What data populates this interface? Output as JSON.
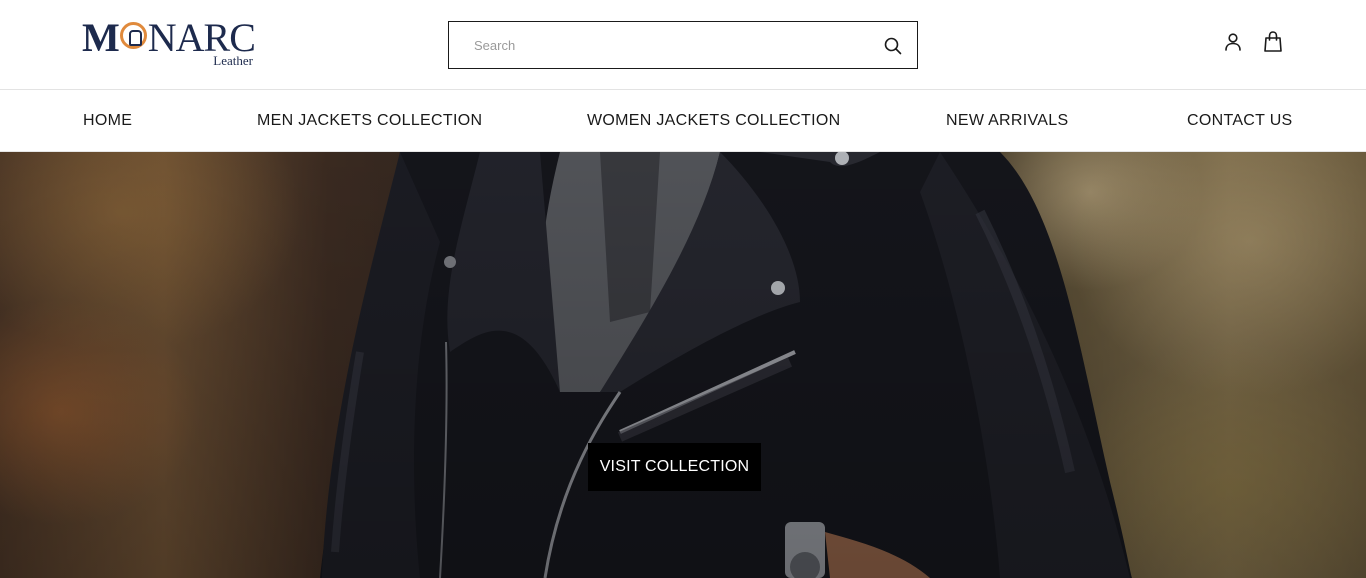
{
  "brand": {
    "name_main": "M○NARC",
    "name_rest": "NARC",
    "name_first": "M",
    "subtitle": "Leather",
    "color_navy": "#1d2a4d",
    "color_orange": "#e08a3c"
  },
  "search": {
    "placeholder": "Search",
    "value": ""
  },
  "header_icons": [
    "account-icon",
    "shopping-bag-icon",
    "search-icon"
  ],
  "nav": {
    "items": [
      {
        "label": "HOME"
      },
      {
        "label": "MEN JACKETS COLLECTION"
      },
      {
        "label": "WOMEN JACKETS COLLECTION"
      },
      {
        "label": "NEW ARRIVALS"
      },
      {
        "label": "CONTACT US"
      }
    ]
  },
  "hero": {
    "cta_label": "VISIT COLLECTION"
  }
}
